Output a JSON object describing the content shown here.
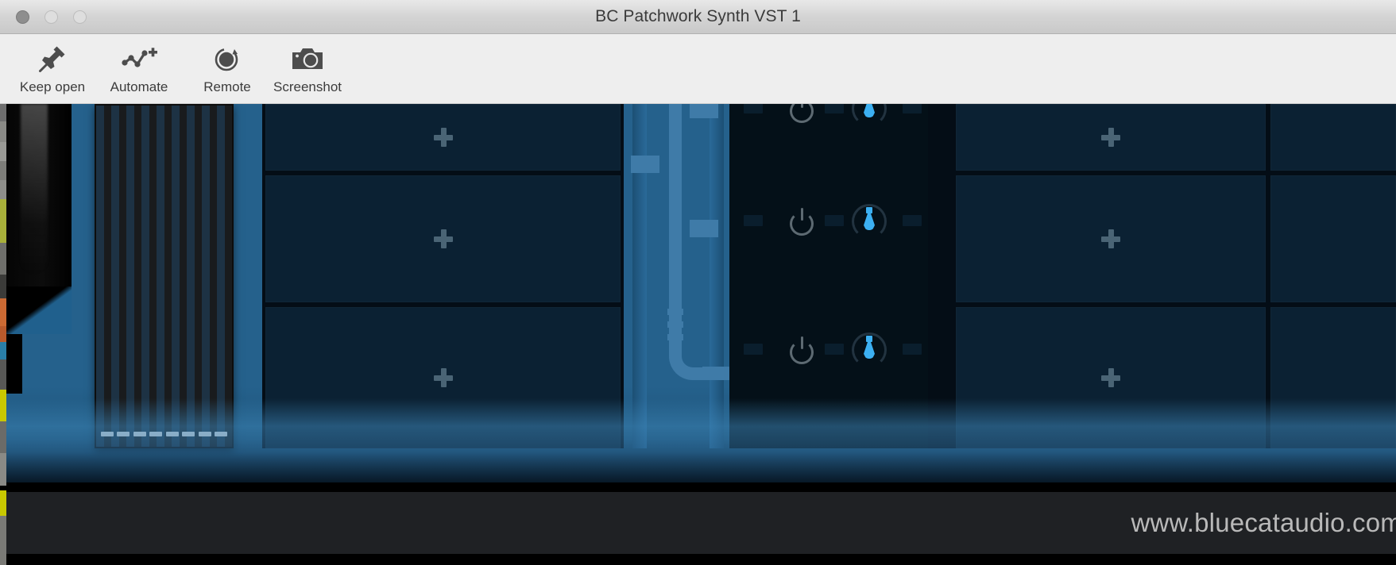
{
  "window": {
    "title": "BC Patchwork Synth VST 1",
    "controls": [
      {
        "name": "close",
        "label": "Close"
      },
      {
        "name": "minimize",
        "label": "Minimize"
      },
      {
        "name": "zoom",
        "label": "Zoom"
      }
    ]
  },
  "toolbar": {
    "items": [
      {
        "label": "Keep open",
        "icon": "pin-icon"
      },
      {
        "label": "Automate",
        "icon": "automate-icon"
      },
      {
        "label": "Remote",
        "icon": "remote-icon"
      },
      {
        "label": "Screenshot",
        "icon": "camera-icon"
      }
    ]
  },
  "plugin": {
    "background_color": "#25618c",
    "accent_color": "#3cb0f2",
    "slot_color": "#0b2133",
    "add_icon": "plus-icon",
    "striped_panel": {
      "name": "keyboard-strip",
      "stripe_dark": "#191b1d",
      "stripe_navy": "#1d3244",
      "dash_count": 8,
      "dash_color": "#e6e6e6"
    },
    "slot_columns": [
      {
        "name": "left-slot-column",
        "slots": [
          {
            "label": "",
            "icon": "plus-icon",
            "state": "empty"
          },
          {
            "label": "",
            "icon": "plus-icon",
            "state": "empty"
          },
          {
            "label": "",
            "icon": "plus-icon",
            "state": "empty"
          }
        ]
      },
      {
        "name": "right-slot-column",
        "slots": [
          {
            "label": "",
            "icon": "plus-icon",
            "state": "empty"
          },
          {
            "label": "",
            "icon": "plus-icon",
            "state": "empty"
          },
          {
            "label": "",
            "icon": "plus-icon",
            "state": "empty"
          }
        ]
      }
    ],
    "channel_strip": {
      "name": "channel-strip",
      "rows": [
        {
          "power": "on",
          "knob_value": 50,
          "knob_color": "#3cb0f2"
        },
        {
          "power": "on",
          "knob_value": 50,
          "knob_color": "#3cb0f2"
        },
        {
          "power": "on",
          "knob_value": 50,
          "knob_color": "#3cb0f2"
        }
      ]
    },
    "routing": {
      "name": "patch-cable",
      "color": "#3f7ba8",
      "tabs": 3,
      "ticks": 3
    }
  },
  "footer": {
    "url": "www.bluecataudio.com"
  }
}
